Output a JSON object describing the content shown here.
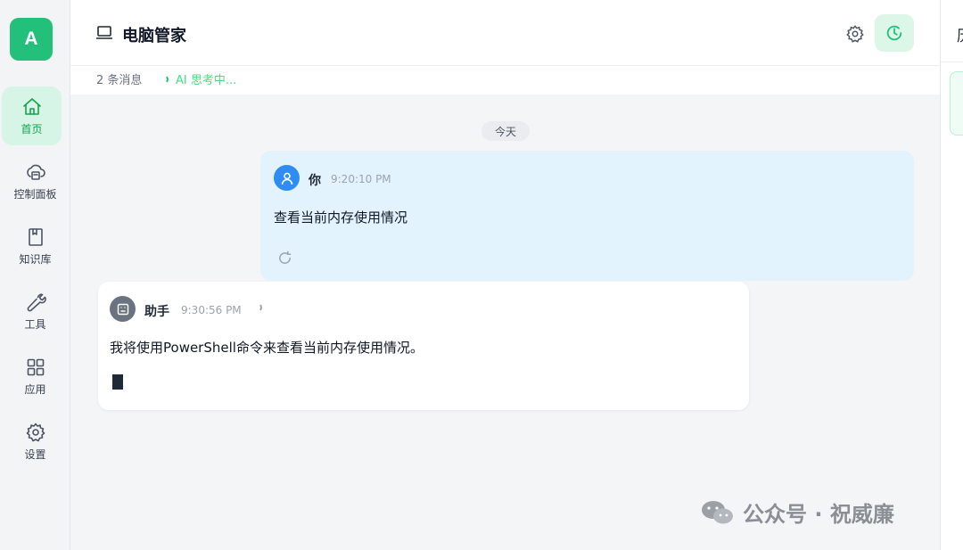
{
  "app": {
    "logo_letter": "A"
  },
  "sidebar": {
    "items": [
      {
        "label": "首页",
        "icon": "home-icon",
        "active": true
      },
      {
        "label": "控制面板",
        "icon": "cloud-server-icon",
        "active": false
      },
      {
        "label": "知识库",
        "icon": "book-icon",
        "active": false
      },
      {
        "label": "工具",
        "icon": "wrench-icon",
        "active": false
      },
      {
        "label": "应用",
        "icon": "apps-grid-icon",
        "active": false
      },
      {
        "label": "设置",
        "icon": "gear-icon",
        "active": false
      }
    ]
  },
  "header": {
    "title": "电脑管家",
    "title_icon": "laptop-icon"
  },
  "subheader": {
    "message_count": "2 条消息",
    "status": "AI 思考中..."
  },
  "chat": {
    "date_label": "今天",
    "messages": [
      {
        "role": "user",
        "name": "你",
        "time": "9:20:10 PM",
        "text": "查看当前内存使用情况"
      },
      {
        "role": "assistant",
        "name": "助手",
        "time": "9:30:56 PM",
        "text": "我将使用PowerShell命令来查看当前内存使用情况。"
      }
    ]
  },
  "watermark": {
    "text": "公众号 · 祝威廉"
  },
  "right_panel": {
    "partial_char": "历"
  },
  "colors": {
    "accent": "#22c07a",
    "user_bubble": "#e2f3fd",
    "user_avatar": "#2f8cf5"
  }
}
